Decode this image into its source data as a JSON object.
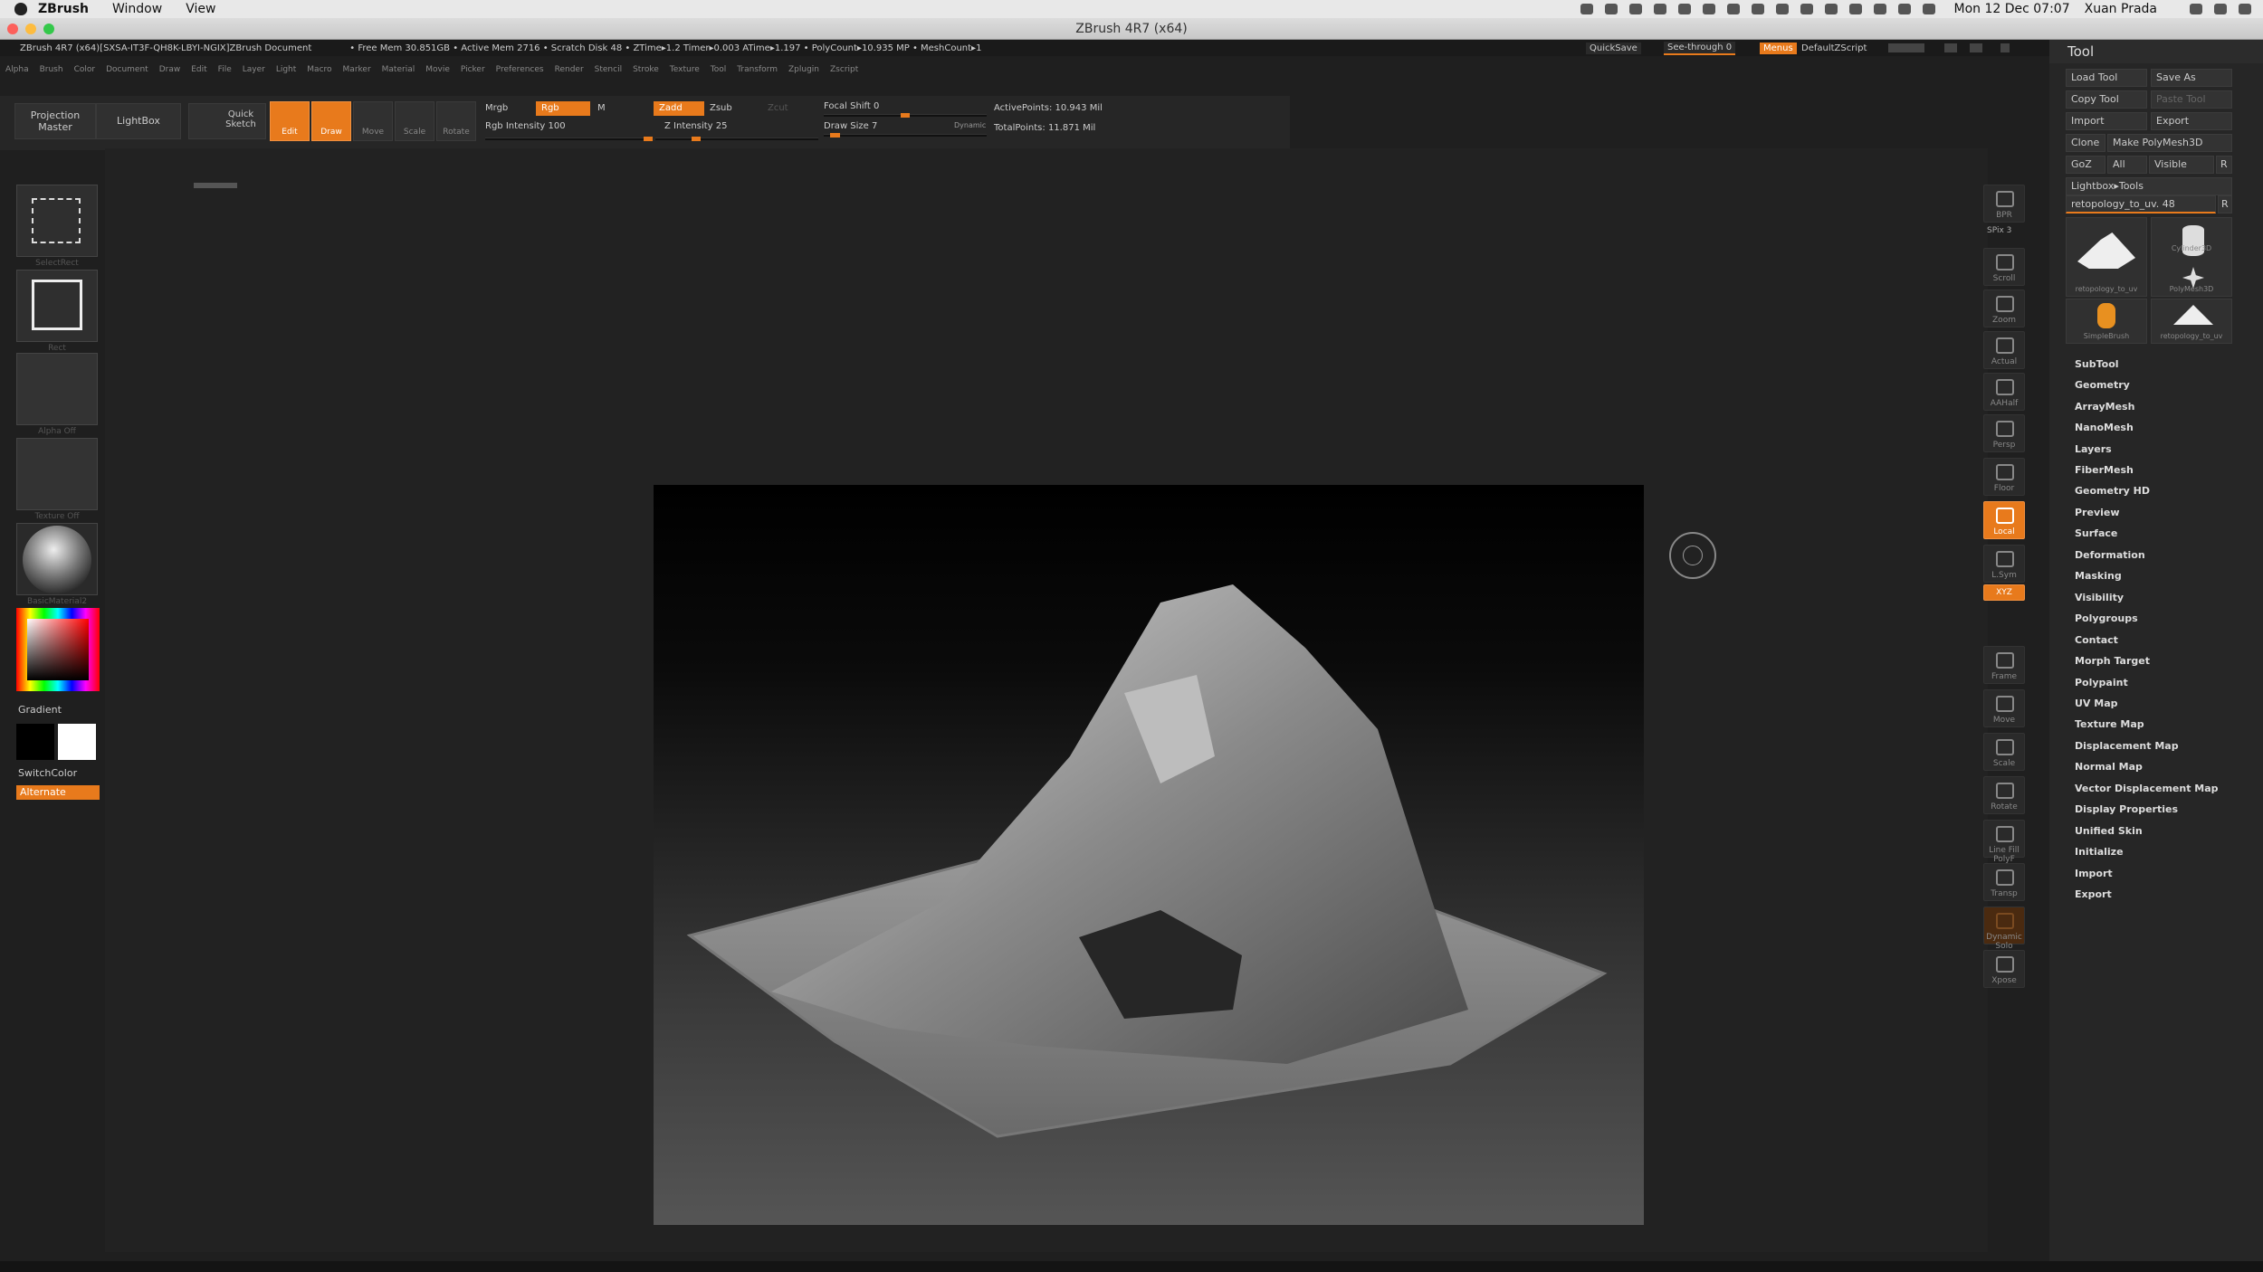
{
  "mac_menu": {
    "app": "ZBrush",
    "items": [
      "Window",
      "View"
    ],
    "clock": "Mon 12 Dec 07:07",
    "user": "Xuan Prada"
  },
  "window": {
    "title": "ZBrush 4R7 (x64)"
  },
  "info_bar": {
    "doc": "ZBrush 4R7 (x64)[SXSA-IT3F-QH8K-LBYI-NGIX]ZBrush Document",
    "stats": "• Free Mem 30.851GB • Active Mem 2716 • Scratch Disk 48 • ZTime▸1.2 Timer▸0.003 ATime▸1.197 • PolyCount▸10.935 MP • MeshCount▸1",
    "quicksave": "QuickSave",
    "see_through": "See-through  0",
    "menus_btn": "Menus",
    "zscript": "DefaultZScript"
  },
  "menu_row": [
    "Alpha",
    "Brush",
    "Color",
    "Document",
    "Draw",
    "Edit",
    "File",
    "Layer",
    "Light",
    "Macro",
    "Marker",
    "Material",
    "Movie",
    "Picker",
    "Preferences",
    "Render",
    "Stencil",
    "Stroke",
    "Texture",
    "Tool",
    "Transform",
    "Zplugin",
    "Zscript"
  ],
  "toolbar": {
    "projection_master": "Projection Master",
    "lightbox": "LightBox",
    "quick_sketch": "Quick Sketch",
    "edit": "Edit",
    "draw": "Draw",
    "move": "Move",
    "scale": "Scale",
    "rotate": "Rotate",
    "mrgb": "Mrgb",
    "rgb": "Rgb",
    "m": "M",
    "zadd": "Zadd",
    "zsub": "Zsub",
    "zcut": "Zcut",
    "rgb_intensity": "Rgb  Intensity 100",
    "rgb_intensity_value": 1.0,
    "z_intensity": "Z Intensity 25",
    "z_intensity_value": 0.25,
    "focal_shift": "Focal Shift 0",
    "focal_shift_value": 0.5,
    "draw_size": "Draw Size 7",
    "draw_size_value": 0.07,
    "dynamic": "Dynamic",
    "active_points": "ActivePoints: 10.943  Mil",
    "total_points": "TotalPoints: 11.871  Mil"
  },
  "left_shelf": {
    "slots": [
      "SelectRect",
      "Rect",
      "Alpha  Off",
      "Texture  Off",
      "BasicMaterial2"
    ],
    "gradient": "Gradient",
    "switch_color": "SwitchColor",
    "alternate": "Alternate"
  },
  "right_shelf": [
    "BPR",
    "SPix 3",
    "Scroll",
    "Zoom",
    "Actual",
    "AAHalf",
    "Persp",
    "Floor",
    "Local",
    "L.Sym",
    "XYZ",
    "Frame",
    "Move",
    "Scale",
    "Rotate",
    "Line Fill PolyF",
    "Transp",
    "Dynamic Solo",
    "Xpose"
  ],
  "tool_panel": {
    "title": "Tool",
    "buttons": [
      "Load Tool",
      "Save As",
      "Copy Tool",
      "Paste Tool",
      "Import",
      "Export",
      "Clone",
      "Make PolyMesh3D",
      "GoZ",
      "All",
      "Visible",
      "R"
    ],
    "lightbox_tools": "Lightbox▸Tools",
    "current_tool": "retopology_to_uv. 48",
    "current_tool_r": "R",
    "thumbs": [
      "retopology_to_uv",
      "Cylinder3D",
      "PolyMesh3D",
      "SimpleBrush",
      "retopology_to_uv"
    ],
    "sections": [
      "SubTool",
      "Geometry",
      "ArrayMesh",
      "NanoMesh",
      "Layers",
      "FiberMesh",
      "Geometry HD",
      "Preview",
      "Surface",
      "Deformation",
      "Masking",
      "Visibility",
      "Polygroups",
      "Contact",
      "Morph Target",
      "Polypaint",
      "UV Map",
      "Texture Map",
      "Displacement Map",
      "Normal Map",
      "Vector Displacement Map",
      "Display Properties",
      "Unified Skin",
      "Initialize",
      "Import",
      "Export"
    ]
  },
  "colors": {
    "accent": "#e87a1c",
    "bg": "#1f1f1f",
    "panel": "#262626"
  }
}
